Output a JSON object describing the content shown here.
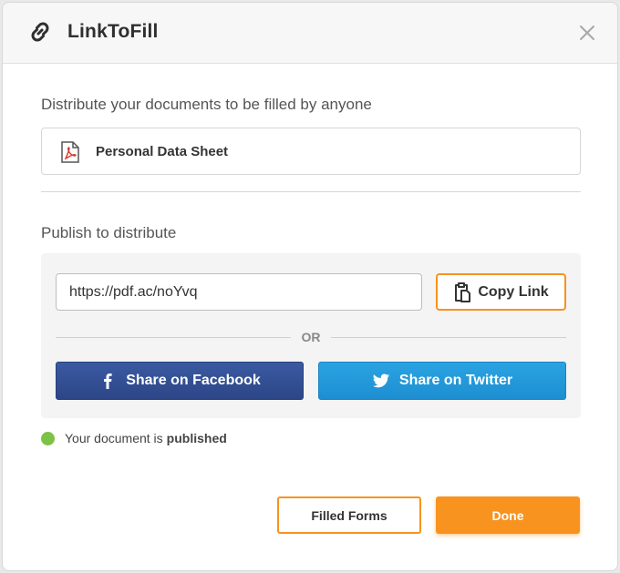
{
  "header": {
    "title": "LinkToFill",
    "icon": "link-icon",
    "close_icon": "close-icon"
  },
  "intro_text": "Distribute your documents to be filled by anyone",
  "document": {
    "icon": "pdf-file-icon",
    "name": "Personal Data Sheet"
  },
  "publish": {
    "label": "Publish to distribute",
    "link_value": "https://pdf.ac/noYvq",
    "copy_label": "Copy Link",
    "copy_icon": "clipboard-icon",
    "or_text": "OR",
    "facebook_label": "Share on Facebook",
    "twitter_label": "Share on Twitter"
  },
  "status": {
    "prefix": "Your document is",
    "value": "published",
    "color": "#7cc245"
  },
  "footer": {
    "filled_forms_label": "Filled Forms",
    "done_label": "Done"
  },
  "colors": {
    "accent": "#f7931e",
    "facebook": "#3b5998",
    "twitter": "#1da1f2"
  }
}
